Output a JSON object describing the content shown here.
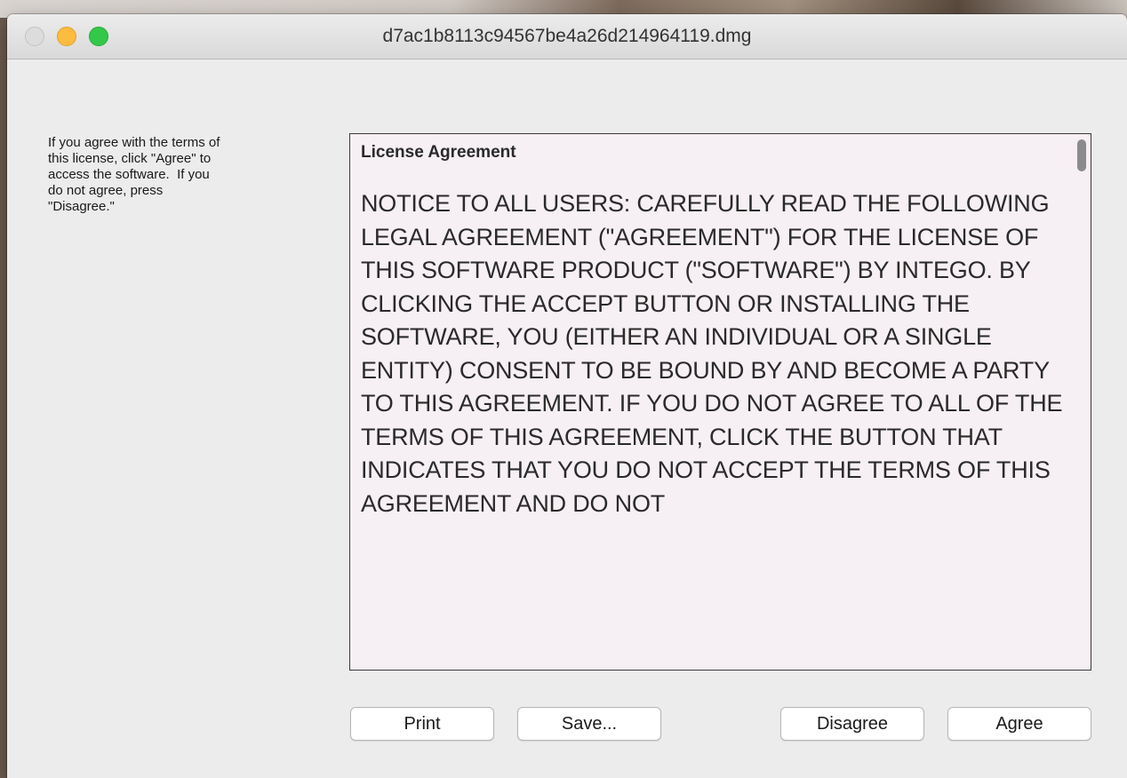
{
  "window": {
    "title": "d7ac1b8113c94567be4a26d214964119.dmg"
  },
  "instructions": {
    "text": "If you agree with the terms of\nthis license, click \"Agree\" to\naccess the software.  If you\ndo not agree, press\n\"Disagree.\""
  },
  "license": {
    "heading": "License Agreement",
    "body": "NOTICE TO ALL USERS: CAREFULLY READ THE FOLLOWING LEGAL AGREEMENT (\"AGREEMENT\") FOR THE LICENSE OF THIS SOFTWARE PRODUCT (\"SOFTWARE\") BY INTEGO. BY CLICKING THE ACCEPT BUTTON OR INSTALLING THE SOFTWARE, YOU (EITHER AN INDIVIDUAL OR A SINGLE ENTITY) CONSENT TO BE BOUND BY AND BECOME A PARTY TO THIS AGREEMENT. IF YOU DO NOT AGREE TO ALL OF THE TERMS OF THIS AGREEMENT, CLICK THE BUTTON THAT INDICATES THAT YOU DO NOT ACCEPT THE TERMS OF THIS AGREEMENT AND DO NOT"
  },
  "buttons": {
    "print": "Print",
    "save": "Save...",
    "disagree": "Disagree",
    "agree": "Agree"
  },
  "colors": {
    "close_light": "#dcdcdc",
    "minimize_light": "#fdbc40",
    "zoom_light": "#34c84a",
    "license_background": "#f6eff3"
  }
}
